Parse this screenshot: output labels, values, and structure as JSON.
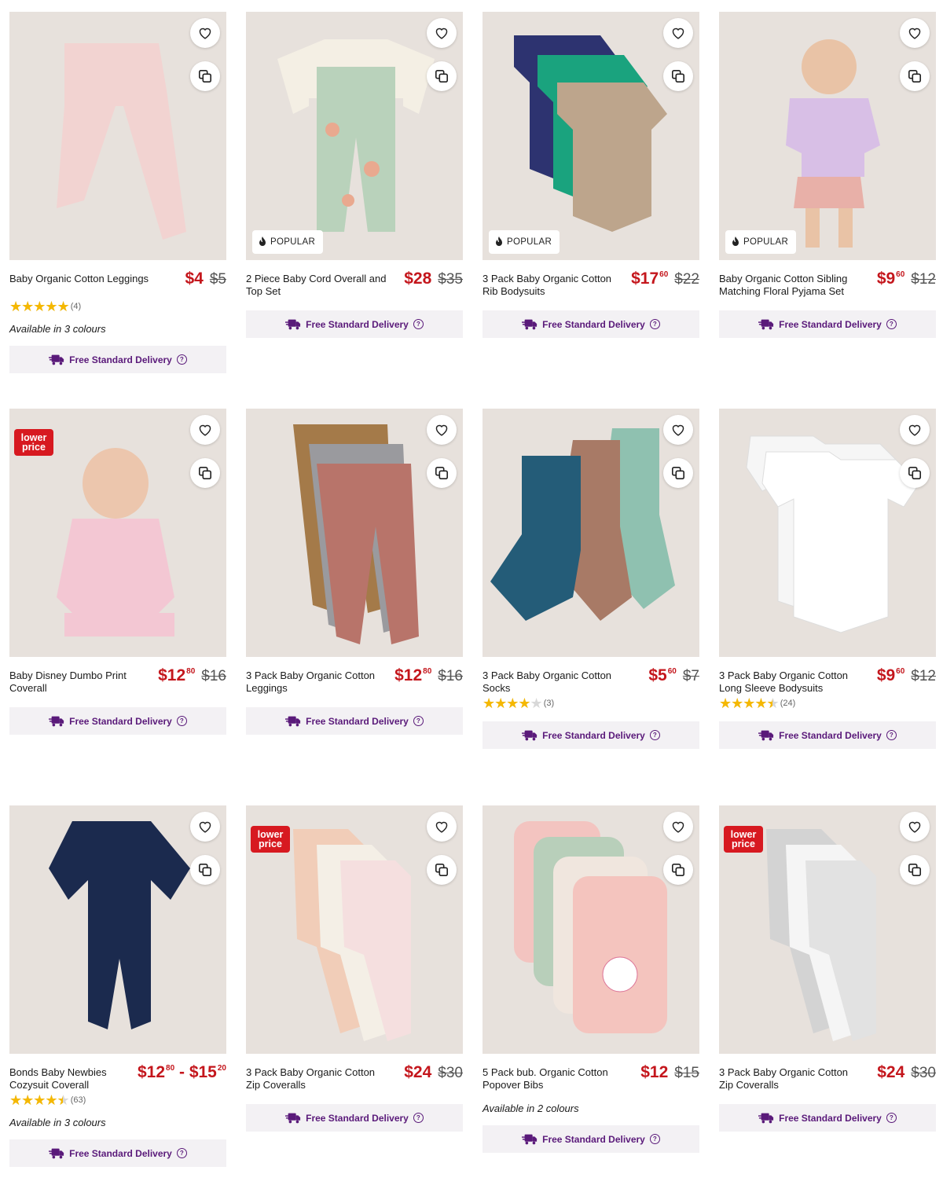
{
  "delivery_label": "Free Standard Delivery",
  "popular_label": "POPULAR",
  "lower_price_label": [
    "lower",
    "price"
  ],
  "products": [
    {
      "name": "Baby Organic Cotton Leggings",
      "price": "$4",
      "price_cents": "",
      "was": "$5",
      "was_cents": "",
      "rating": 5,
      "reviews": "(4)",
      "colours": "Available in 3 colours",
      "badge": "",
      "art": "leggings-pink"
    },
    {
      "name": "2 Piece Baby Cord Overall and Top Set",
      "price": "$28",
      "price_cents": "",
      "was": "$35",
      "was_cents": "",
      "rating": null,
      "reviews": "",
      "colours": "",
      "badge": "popular",
      "art": "overall"
    },
    {
      "name": "3 Pack Baby Organic Cotton Rib Bodysuits",
      "price": "$17",
      "price_cents": "60",
      "was": "$22",
      "was_cents": "",
      "rating": null,
      "reviews": "",
      "colours": "",
      "badge": "popular",
      "art": "bodysuits"
    },
    {
      "name": "Baby Organic Cotton Sibling Matching Floral Pyjama Set",
      "price": "$9",
      "price_cents": "60",
      "was": "$12",
      "was_cents": "",
      "rating": null,
      "reviews": "",
      "colours": "",
      "badge": "popular",
      "art": "pyjama"
    },
    {
      "name": "Baby Disney Dumbo Print Coverall",
      "price": "$12",
      "price_cents": "80",
      "was": "$16",
      "was_cents": "",
      "rating": null,
      "reviews": "",
      "colours": "",
      "badge": "lower",
      "art": "baby-pink"
    },
    {
      "name": "3 Pack Baby Organic Cotton Leggings",
      "price": "$12",
      "price_cents": "80",
      "was": "$16",
      "was_cents": "",
      "rating": null,
      "reviews": "",
      "colours": "",
      "badge": "",
      "art": "leggings-fox"
    },
    {
      "name": "3 Pack Baby Organic Cotton Socks",
      "price": "$5",
      "price_cents": "60",
      "was": "$7",
      "was_cents": "",
      "rating": 4,
      "reviews": "(3)",
      "colours": "",
      "badge": "",
      "art": "socks"
    },
    {
      "name": "3 Pack Baby Organic Cotton Long Sleeve Bodysuits",
      "price": "$9",
      "price_cents": "60",
      "was": "$12",
      "was_cents": "",
      "rating": 4.5,
      "reviews": "(24)",
      "colours": "",
      "badge": "",
      "art": "white-bodysuits"
    },
    {
      "name": "Bonds Baby Newbies Cozysuit Coverall",
      "price": "$12",
      "price_cents": "80",
      "price2": "$15",
      "price2_cents": "20",
      "was": "",
      "was_cents": "",
      "rating": 4.5,
      "reviews": "(63)",
      "colours": "Available in 3 colours",
      "badge": "",
      "art": "navy-coverall"
    },
    {
      "name": "3 Pack Baby Organic Cotton Zip Coveralls",
      "price": "$24",
      "price_cents": "",
      "was": "$30",
      "was_cents": "",
      "rating": null,
      "reviews": "",
      "colours": "",
      "badge": "lower",
      "art": "zip-pink"
    },
    {
      "name": "5 Pack bub. Organic Cotton Popover Bibs",
      "price": "$12",
      "price_cents": "",
      "was": "$15",
      "was_cents": "",
      "rating": null,
      "reviews": "",
      "colours": "Available in 2 colours",
      "badge": "",
      "art": "bibs"
    },
    {
      "name": "3 Pack Baby Organic Cotton Zip Coveralls",
      "price": "$24",
      "price_cents": "",
      "was": "$30",
      "was_cents": "",
      "rating": null,
      "reviews": "",
      "colours": "",
      "badge": "lower",
      "art": "zip-grey"
    }
  ]
}
